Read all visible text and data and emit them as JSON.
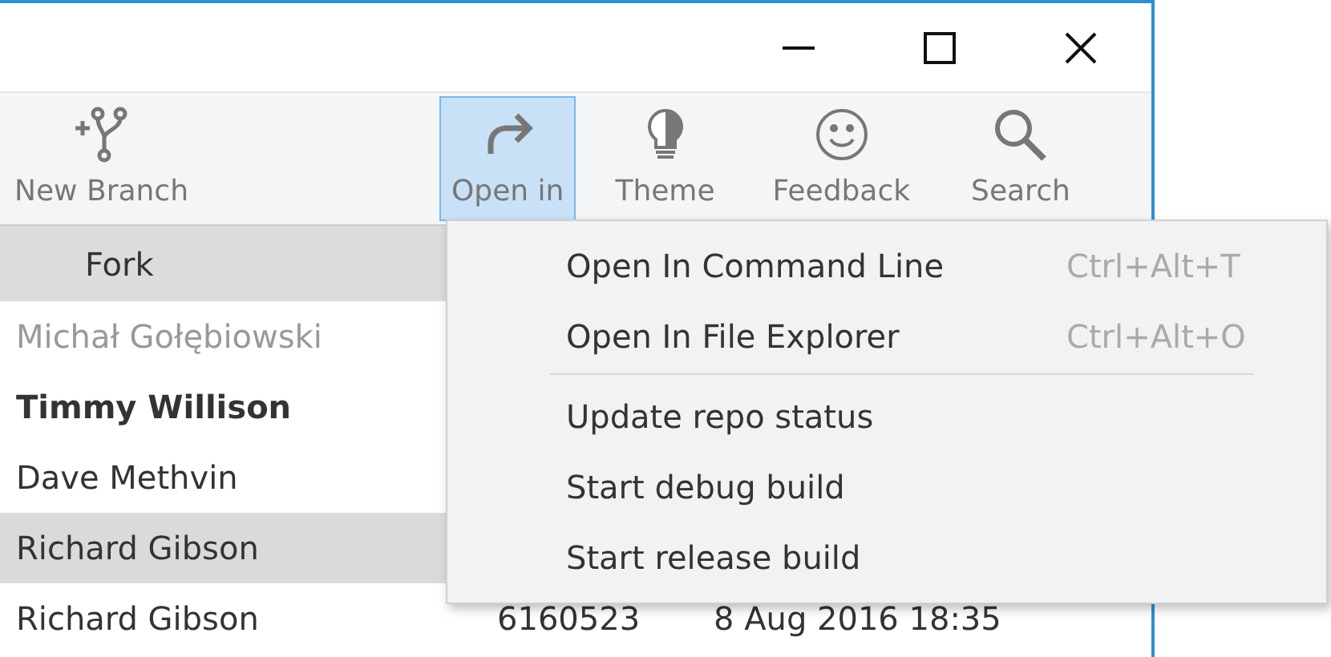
{
  "toolbar": [
    {
      "label": "New Branch",
      "selected": false
    },
    {
      "label": "Open in",
      "selected": true
    },
    {
      "label": "Theme",
      "selected": false
    },
    {
      "label": "Feedback",
      "selected": false
    },
    {
      "label": "Search",
      "selected": false
    }
  ],
  "branch_header": "Fork",
  "commits": [
    {
      "author": "Michał Gołębiowski",
      "kind": "muted",
      "selected": false
    },
    {
      "author": "Timmy Willison",
      "kind": "bold",
      "selected": false
    },
    {
      "author": "Dave Methvin",
      "kind": "normal",
      "selected": false
    },
    {
      "author": "Richard Gibson",
      "kind": "normal",
      "selected": true
    },
    {
      "author": "Richard Gibson",
      "hash": "6160523",
      "date": "8 Aug 2016 18:35",
      "kind": "normal",
      "selected": false
    }
  ],
  "menu": {
    "groups": [
      [
        {
          "label": "Open In Command Line",
          "shortcut": "Ctrl+Alt+T"
        },
        {
          "label": "Open In File Explorer",
          "shortcut": "Ctrl+Alt+O"
        }
      ],
      [
        {
          "label": "Update repo status"
        },
        {
          "label": "Start debug build"
        },
        {
          "label": "Start release build"
        }
      ]
    ]
  }
}
